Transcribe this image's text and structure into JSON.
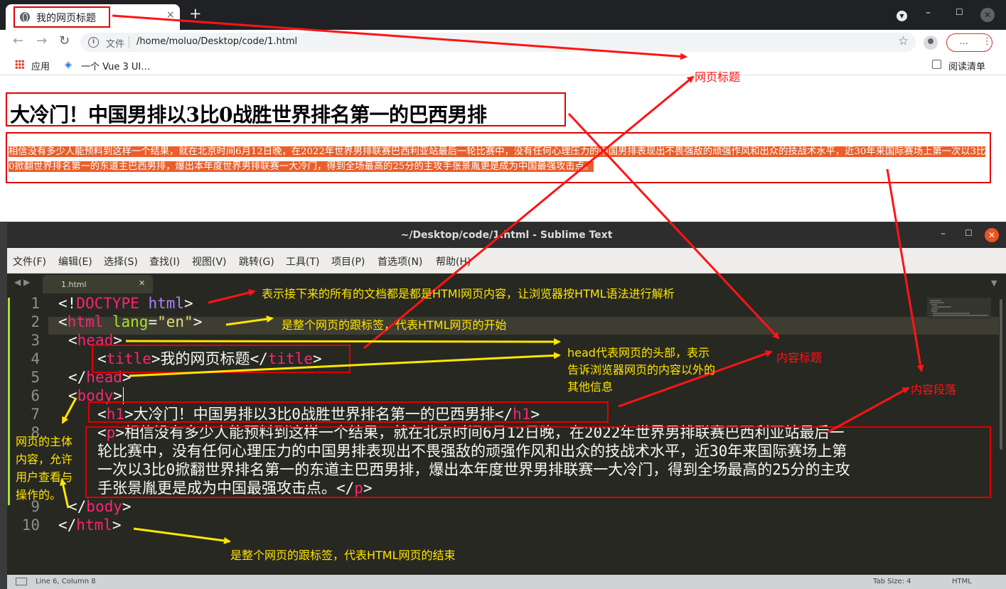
{
  "browser": {
    "tab_title": "我的网页标题",
    "tab_close": "×",
    "new_tab": "+",
    "url_scheme": "文件",
    "url": "/home/moluo/Desktop/code/1.html",
    "update_button": "…",
    "bookmarks": [
      {
        "label": "应用"
      },
      {
        "label": "一个 Vue 3 UI…"
      }
    ],
    "reading_list": "阅读清单",
    "page": {
      "h1": "大冷门！中国男排以3比0战胜世界排名第一的巴西男排",
      "p": "相信没有多少人能预料到这样一个结果，就在北京时间6月12日晚，在2022年世界男排联赛巴西利亚站最后一轮比赛中，没有任何心理压力的中国男排表现出不畏强敌的顽强作风和出众的技战术水平，近30年来国际赛场上第一次以3比0掀翻世界排名第一的东道主巴西男排，爆出本年度世界男排联赛一大冷门，得到全场最高的25分的主攻手张景胤更是成为中国最强攻击点。"
    },
    "colors": {
      "chrome_dark": "#202124",
      "selection": "#e85f2c",
      "update_accent": "#d93025"
    }
  },
  "sublime": {
    "title": "~/Desktop/code/1.html - Sublime Text",
    "menu": [
      "文件(F)",
      "编辑(E)",
      "选择(S)",
      "查找(I)",
      "视图(V)",
      "跳转(G)",
      "工具(T)",
      "项目(P)",
      "首选项(N)",
      "帮助(H)"
    ],
    "file_tab": "1.html",
    "line_numbers": [
      "1",
      "2",
      "3",
      "4",
      "5",
      "6",
      "7",
      "8",
      "9",
      "10"
    ],
    "code": {
      "l1": {
        "a": "<!",
        "b": "DOCTYPE",
        "c": " html",
        "d": ">"
      },
      "l2": {
        "a": "<",
        "b": "html",
        "c": " lang",
        "d": "=",
        "e": "\"en\"",
        "f": ">"
      },
      "l3": {
        "a": "<",
        "b": "head",
        "c": ">"
      },
      "l4": {
        "a": "<",
        "b": "title",
        "c": ">我的网页标题</",
        "d": "title",
        "e": ">"
      },
      "l5": {
        "a": "</",
        "b": "head",
        "c": ">"
      },
      "l6": {
        "a": "<",
        "b": "body",
        "c": ">"
      },
      "l7": {
        "a": "<",
        "b": "h1",
        "c": ">大冷门！中国男排以3比0战胜世界排名第一的巴西男排</",
        "d": "h1",
        "e": ">"
      },
      "l8": {
        "a": "<",
        "b": "p",
        "c": ">相信没有多少人能预料到这样一个结果，就在北京时间6月12日晚，在2022年世界男排联赛巴西利亚站最后一"
      },
      "l8b": "轮比赛中，没有任何心理压力的中国男排表现出不畏强敌的顽强作风和出众的技战术水平，近30年来国际赛场上第",
      "l8c": "一次以3比0掀翻世界排名第一的东道主巴西男排，爆出本年度世界男排联赛一大冷门，得到全场最高的25分的主攻",
      "l8d": {
        "a": "手张景胤更是成为中国最强攻击点。</",
        "b": "p",
        "c": ">"
      },
      "l9": {
        "a": "</",
        "b": "body",
        "c": ">"
      },
      "l10": {
        "a": "</",
        "b": "html",
        "c": ">"
      }
    },
    "status": {
      "position": "Line 6, Column 8",
      "tab_size": "Tab Size: 4",
      "syntax": "HTML"
    },
    "colors": {
      "bg": "#272822",
      "tag": "#f92672",
      "attr": "#a6e22e",
      "string": "#e6db74"
    }
  },
  "annotations": {
    "page_title": "网页标题",
    "content_title": "内容标题",
    "content_paragraph": "内容段落",
    "doctype": "表示接下来的所有的文档都是都是HTMl网页内容，让浏览器按HTML语法进行解析",
    "html_start": "是整个网页的跟标签，代表HTML网页的开始",
    "head_l1": "head代表网页的头部，表示",
    "head_l2": "告诉浏览器网页的内容以外的",
    "head_l3": "其他信息",
    "body_l1": "网页的主体",
    "body_l2": "内容，允许",
    "body_l3": "用户查看与",
    "body_l4": "操作的。",
    "html_end": "是整个网页的跟标签，代表HTML网页的结束",
    "colors": {
      "note_yellow": "#ffe600",
      "note_red": "#ff1414",
      "box": "#e00000"
    }
  }
}
